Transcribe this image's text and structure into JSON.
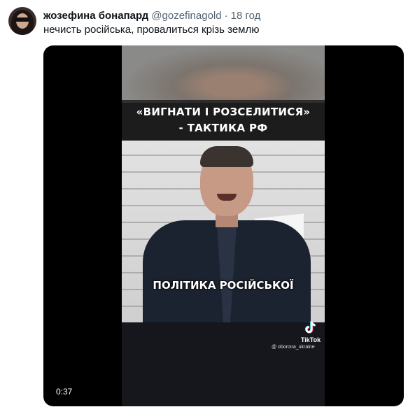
{
  "tweet": {
    "author_name": "жозефина бонапард",
    "author_handle": "@gozefinagold",
    "separator": "·",
    "time": "18 год",
    "text": "нечисть російська, провалиться крізь землю"
  },
  "video": {
    "banner_line1": "«ВИГНАТИ І РОЗСЕЛИТИСЯ»",
    "banner_line2": "- ТАКТИКА РФ",
    "caption": "ПОЛІТИКА РОСІЙСЬКОЇ",
    "watermark_label": "TikTok",
    "watermark_user": "@ oborona_ukraine",
    "duration": "0:37"
  },
  "colors": {
    "secondary_text": "#536471",
    "primary_text": "#0f1419",
    "media_background": "#000000"
  }
}
